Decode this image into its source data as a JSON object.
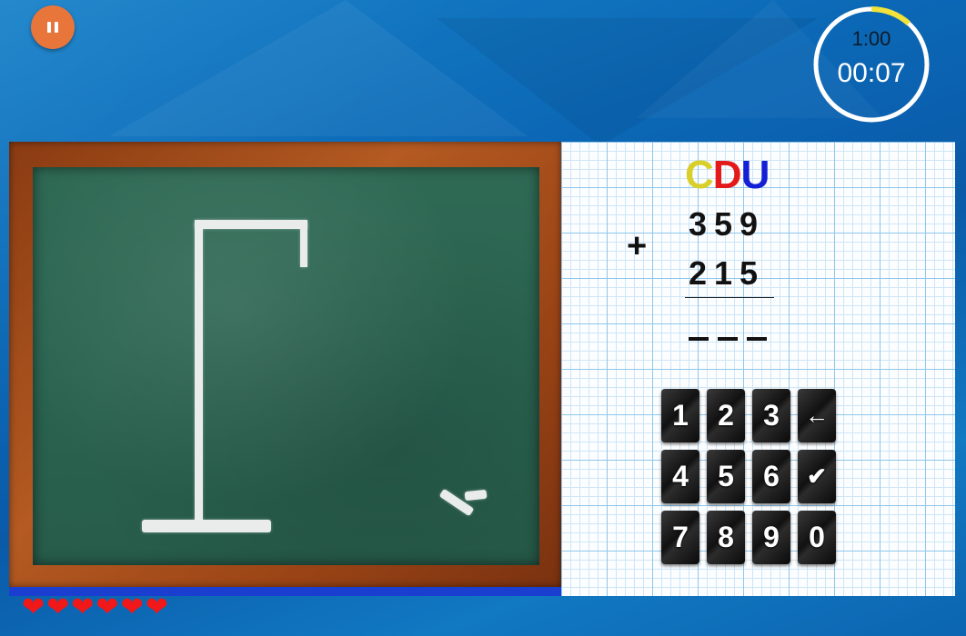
{
  "timer": {
    "limit": "1:00",
    "elapsed": "00:07",
    "progress": 0.117
  },
  "problem": {
    "place_labels": [
      {
        "text": "C",
        "color": "#d9cf2a"
      },
      {
        "text": "D",
        "color": "#e41a1a"
      },
      {
        "text": "U",
        "color": "#1420d6"
      }
    ],
    "operator": "+",
    "addend1": "359",
    "addend2": "215",
    "answer_blanks": 3
  },
  "keypad": {
    "keys": [
      {
        "label": "1",
        "name": "key-1"
      },
      {
        "label": "2",
        "name": "key-2"
      },
      {
        "label": "3",
        "name": "key-3"
      },
      {
        "label": "←",
        "name": "backspace-key",
        "icon": "arrow-left-icon"
      },
      {
        "label": "4",
        "name": "key-4"
      },
      {
        "label": "5",
        "name": "key-5"
      },
      {
        "label": "6",
        "name": "key-6"
      },
      {
        "label": "✔",
        "name": "submit-key",
        "icon": "check-circle-icon"
      },
      {
        "label": "7",
        "name": "key-7"
      },
      {
        "label": "8",
        "name": "key-8"
      },
      {
        "label": "9",
        "name": "key-9"
      },
      {
        "label": "0",
        "name": "key-0"
      }
    ]
  },
  "lives": {
    "count": 6,
    "icon": "heart-icon",
    "color": "#f01818"
  },
  "colors": {
    "accent": "#e8763a",
    "timer_progress": "#f2e23a"
  }
}
